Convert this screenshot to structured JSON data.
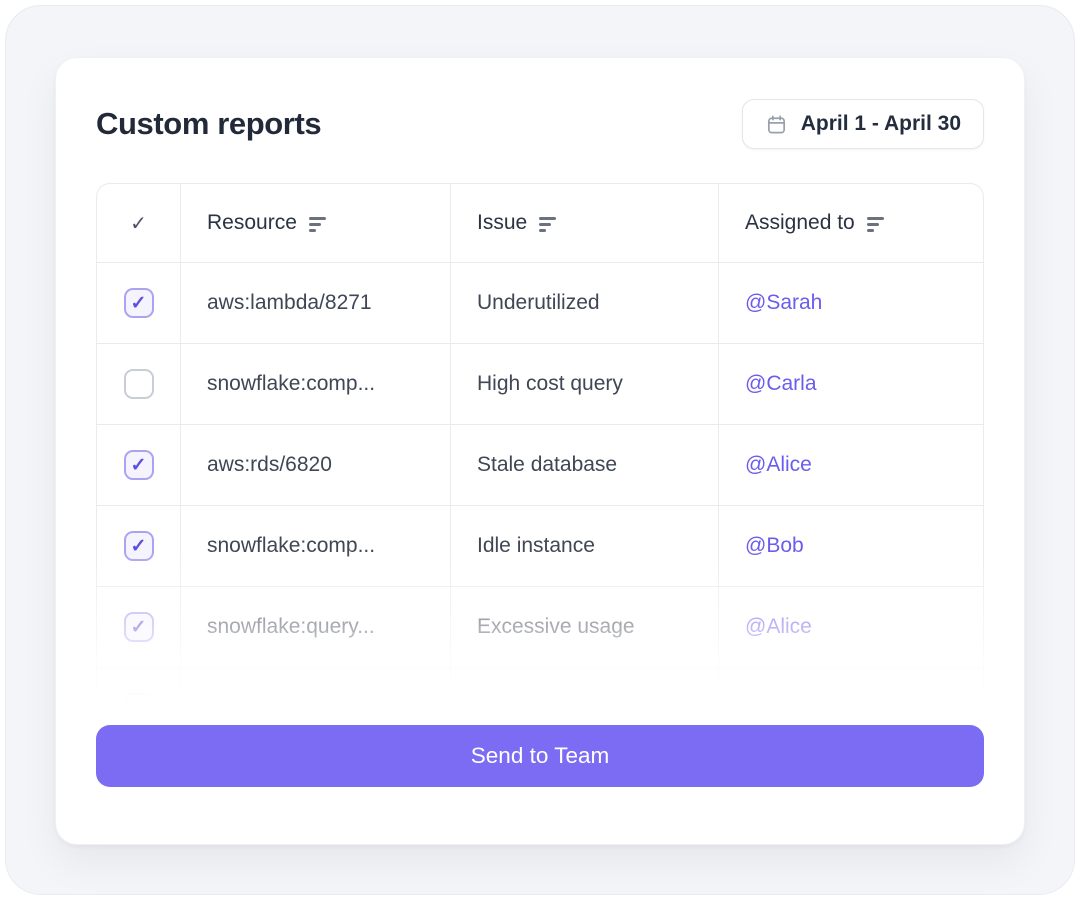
{
  "card": {
    "title": "Custom reports",
    "date_range_button": {
      "icon": "calendar-icon",
      "label": "April 1 - April 30"
    },
    "table": {
      "select_column_glyph": "✓",
      "checkbox_glyph": "✓",
      "columns": [
        {
          "label": "Resource"
        },
        {
          "label": "Issue"
        },
        {
          "label": "Assigned to"
        }
      ],
      "rows": [
        {
          "checked": true,
          "resource": "aws:lambda/8271",
          "issue": "Underutilized",
          "assignee": "@Sarah"
        },
        {
          "checked": false,
          "resource": "snowflake:comp...",
          "issue": "High cost query",
          "assignee": "@Carla"
        },
        {
          "checked": true,
          "resource": "aws:rds/6820",
          "issue": "Stale database",
          "assignee": "@Alice"
        },
        {
          "checked": true,
          "resource": "snowflake:comp...",
          "issue": "Idle instance",
          "assignee": "@Bob"
        },
        {
          "checked": true,
          "resource": "snowflake:query...",
          "issue": "Excessive usage",
          "assignee": "@Alice"
        },
        {
          "checked": true,
          "resource": "",
          "issue": "",
          "assignee": ""
        }
      ]
    },
    "send_button": {
      "label": "Send to Team"
    }
  },
  "colors": {
    "accent": "#7c6cf3",
    "mention": "#6c5cee",
    "checkbox_checked_border": "#a9a3f1",
    "checkbox_check": "#5a4fe0",
    "title_text": "#222a3a",
    "body_text": "#3f4654",
    "header_text": "#2b3342",
    "table_border": "#e9ebef",
    "page_bg": "#f4f5f8",
    "card_bg": "#ffffff"
  }
}
